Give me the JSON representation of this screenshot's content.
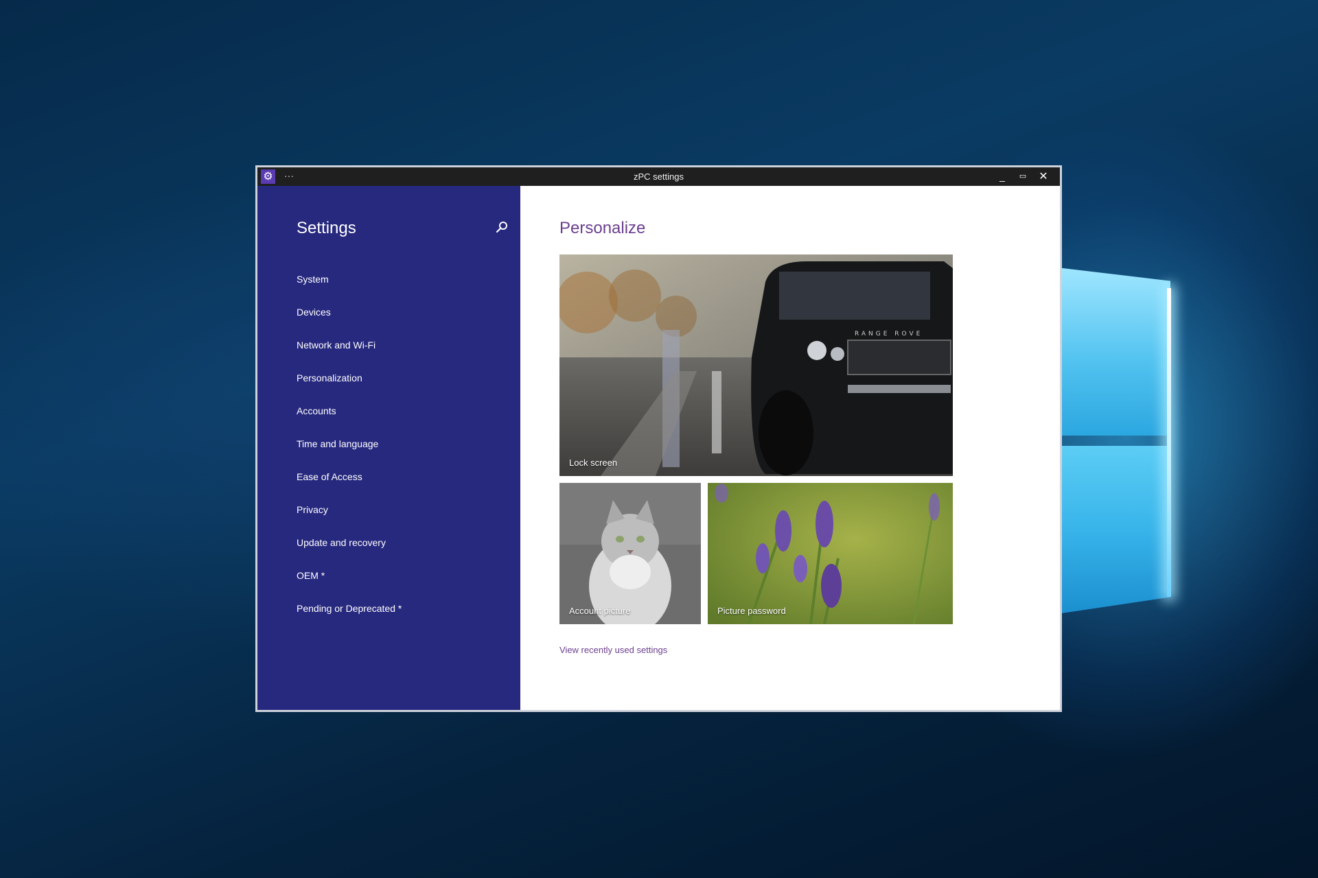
{
  "window": {
    "title": "zPC settings",
    "more_label": "···",
    "controls": {
      "minimize": "_",
      "maximize": "▭",
      "close": "✕"
    }
  },
  "sidebar": {
    "title": "Settings",
    "search_icon": "search-icon",
    "items": [
      {
        "label": "System"
      },
      {
        "label": "Devices"
      },
      {
        "label": "Network and Wi-Fi"
      },
      {
        "label": "Personalization"
      },
      {
        "label": "Accounts"
      },
      {
        "label": "Time and language"
      },
      {
        "label": "Ease of Access"
      },
      {
        "label": "Privacy"
      },
      {
        "label": "Update and recovery"
      },
      {
        "label": "OEM *"
      },
      {
        "label": "Pending or Deprecated *"
      }
    ]
  },
  "main": {
    "title": "Personalize",
    "tiles": {
      "lock_screen": {
        "label": "Lock screen",
        "image_text": "RANGE ROVE"
      },
      "account_picture": {
        "label": "Account picture"
      },
      "picture_password": {
        "label": "Picture password"
      }
    },
    "recent_link": "View recently used settings"
  },
  "colors": {
    "sidebar_bg": "#27297f",
    "accent_purple": "#6b3f8e",
    "titlebar_bg": "#1f1f1f",
    "app_icon_bg": "#5b3bb2"
  }
}
